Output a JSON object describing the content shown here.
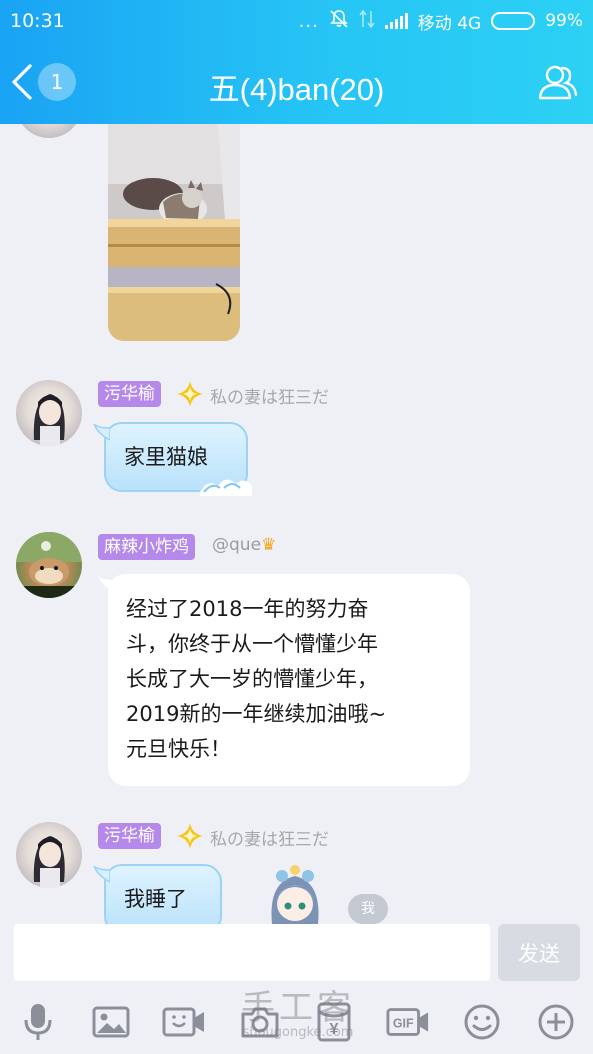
{
  "status_bar": {
    "time": "10:31",
    "dots": "...",
    "carrier": "移动 4G",
    "battery": "99%",
    "battery_level": 0.99
  },
  "header": {
    "title": "五(4)ban(20)",
    "unread_count": "1",
    "back_icon": "chevron-left-icon",
    "members_icon": "group-members-icon"
  },
  "messages": [
    {
      "type": "image",
      "content": "cat-on-bed-photo"
    },
    {
      "sender": "污华榆",
      "title": "私の妻は狂三だ",
      "text": "家里猫娘",
      "bubble_style": "blue-wave"
    },
    {
      "sender": "麻辣小炸鸡",
      "title": "@que",
      "text": "经过了2018一年的努力奋斗，你终于从一个懵懂少年长成了大一岁的懵懂少年，2019新的一年继续加油哦~元旦快乐！",
      "text_lines": [
        "经过了2018一年的努力奋",
        "斗，你终于从一个懵懂少年",
        "长成了大一岁的懵懂少年，",
        "2019新的一年继续加油哦~",
        "元旦快乐！"
      ],
      "bubble_style": "white"
    },
    {
      "sender": "污华榆",
      "title": "私の妻は狂三だ",
      "text": "我睡了",
      "bubble_style": "blue-wave"
    }
  ],
  "me_badge": "我",
  "input": {
    "placeholder": "",
    "value": "",
    "send_label": "发送"
  },
  "toolbar": {
    "items": [
      "microphone-icon",
      "image-icon",
      "video-call-icon",
      "camera-icon",
      "red-packet-icon",
      "gif-icon",
      "emoji-icon",
      "plus-icon"
    ],
    "gif_label": "GIF",
    "yuan_label": "¥"
  },
  "watermark": {
    "main": "手工客",
    "sub": "shougongke.com"
  },
  "colors": {
    "header_gradient_start": "#1aa3f4",
    "header_gradient_end": "#2cd1f4",
    "nickname_badge": "#b589ea",
    "background": "#eef0f6"
  }
}
